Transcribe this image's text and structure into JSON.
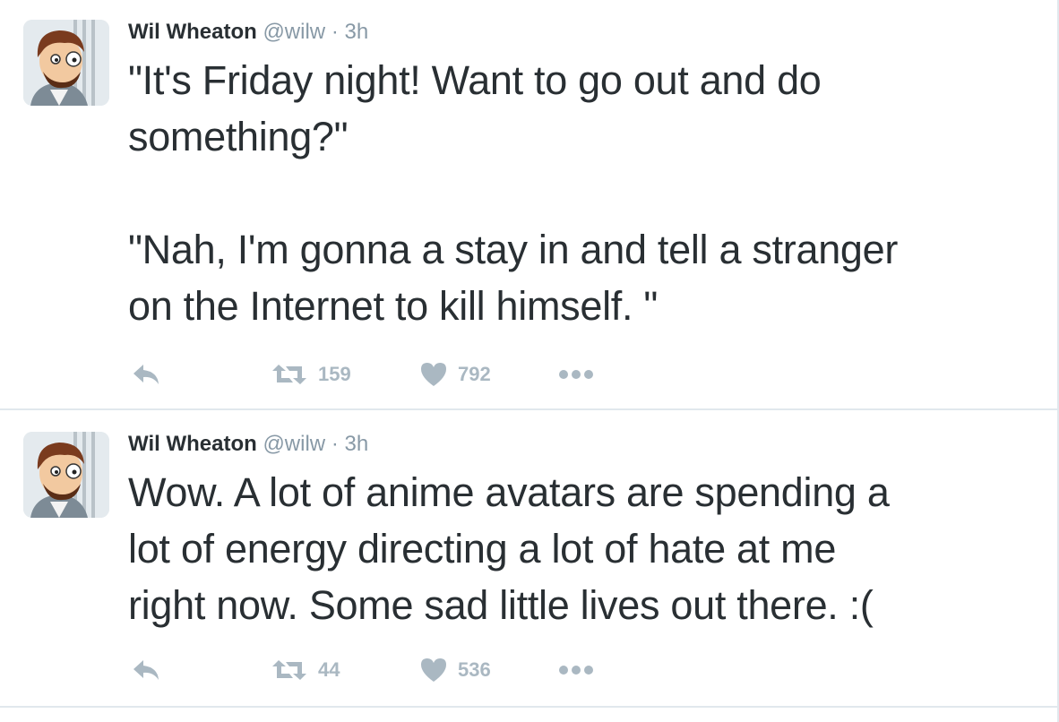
{
  "colors": {
    "text": "#292f33",
    "muted": "#8899a6",
    "icon": "#aab8c2",
    "border": "#e1e8ed"
  },
  "tweets": [
    {
      "name": "Wil Wheaton",
      "handle": "@wilw",
      "separator": "·",
      "time": "3h",
      "lines": [
        "\"It's Friday night! Want to go out and do",
        "something?\"",
        "",
        "\"Nah, I'm gonna a stay in and tell a stranger",
        "on the Internet to kill himself. \""
      ],
      "retweets": "159",
      "likes": "792",
      "icons": {
        "reply": "reply-icon",
        "retweet": "retweet-icon",
        "like": "heart-icon",
        "more": "more-icon"
      }
    },
    {
      "name": "Wil Wheaton",
      "handle": "@wilw",
      "separator": "·",
      "time": "3h",
      "lines": [
        "Wow. A lot of anime avatars are spending a",
        "lot of energy directing a lot of hate at me",
        "right now. Some sad little lives out there. :("
      ],
      "retweets": "44",
      "likes": "536",
      "icons": {
        "reply": "reply-icon",
        "retweet": "retweet-icon",
        "like": "heart-icon",
        "more": "more-icon"
      }
    }
  ]
}
